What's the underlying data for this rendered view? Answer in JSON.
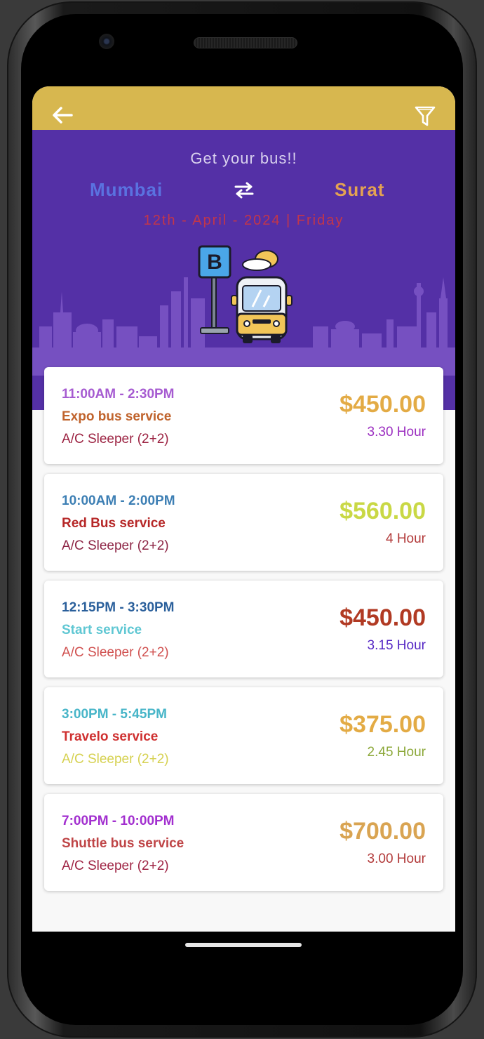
{
  "header": {
    "tagline": "Get your bus!!",
    "from_city": "Mumbai",
    "to_city": "Surat",
    "date": "12th - April - 2024 | Friday",
    "bus_stop_sign": "B"
  },
  "colors": {
    "topbar": "#d7b74f",
    "header_bg": "#5430a6"
  },
  "icons": {
    "back": "arrow-left-icon",
    "filter": "filter-icon",
    "swap": "swap-arrows-icon"
  },
  "buses": [
    {
      "time": "11:00AM - 2:30PM",
      "name": "Expo bus service",
      "type": "A/C Sleeper (2+2)",
      "price": "$450.00",
      "duration": "3.30 Hour",
      "colors": {
        "time": "#a65bd1",
        "name": "#c0632c",
        "type": "#9c2342",
        "price": "#e3ab45",
        "duration": "#9b2ec0"
      }
    },
    {
      "time": "10:00AM - 2:00PM",
      "name": "Red Bus service",
      "type": "A/C Sleeper (2+2)",
      "price": "$560.00",
      "duration": "4 Hour",
      "colors": {
        "time": "#3d7fb4",
        "name": "#b62727",
        "type": "#8d2545",
        "price": "#c9d845",
        "duration": "#b23a3a"
      }
    },
    {
      "time": "12:15PM - 3:30PM",
      "name": "Start service",
      "type": "A/C Sleeper (2+2)",
      "price": "$450.00",
      "duration": "3.15 Hour",
      "colors": {
        "time": "#2a5f9b",
        "name": "#5fc7d3",
        "type": "#d0504f",
        "price": "#b13a23",
        "duration": "#5527c4"
      }
    },
    {
      "time": "3:00PM - 5:45PM",
      "name": "Travelo service",
      "type": "A/C Sleeper (2+2)",
      "price": "$375.00",
      "duration": "2.45 Hour",
      "colors": {
        "time": "#47b5c8",
        "name": "#cf3030",
        "type": "#d6d150",
        "price": "#e3ab45",
        "duration": "#8ca83a"
      }
    },
    {
      "time": "7:00PM - 10:00PM",
      "name": "Shuttle bus service",
      "type": "A/C Sleeper (2+2)",
      "price": "$700.00",
      "duration": "3.00 Hour",
      "colors": {
        "time": "#a22fcf",
        "name": "#bf4547",
        "type": "#9f2444",
        "price": "#d9a452",
        "duration": "#b23a3a"
      }
    }
  ]
}
